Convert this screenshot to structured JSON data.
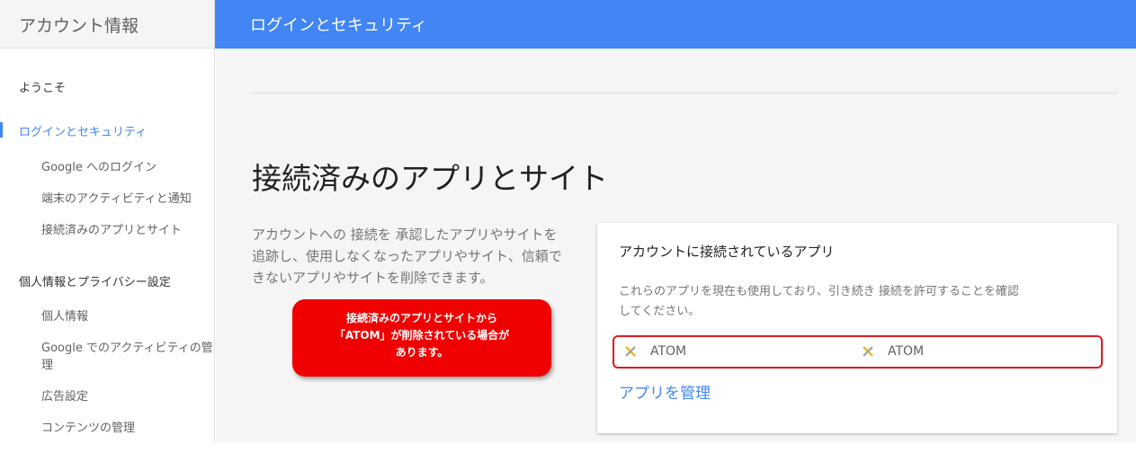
{
  "sidebar": {
    "title": "アカウント情報",
    "items": [
      {
        "label": "ようこそ"
      },
      {
        "label": "ログインとセキュリティ"
      },
      {
        "label": "Google へのログイン"
      },
      {
        "label": "端末のアクティビティと通知"
      },
      {
        "label": "接続済みのアプリとサイト"
      },
      {
        "label": "個人情報とプライバシー設定"
      },
      {
        "label": "個人情報"
      },
      {
        "label": "Google でのアクティビティの管"
      },
      {
        "label": "理"
      },
      {
        "label": "広告設定"
      },
      {
        "label": "コンテンツの管理"
      }
    ]
  },
  "header": {
    "title": "ログインとセキュリティ"
  },
  "main": {
    "section_title": "接続済みのアプリとサイト",
    "description_lines": [
      "アカウントへの 接続を 承認したアプリやサイトを",
      "追跡し、使用しなくなったアプリやサイト、信頼で",
      "きないアプリやサイトを削除できます。"
    ]
  },
  "card": {
    "title": "アカウントに接続されているアプリ",
    "description_lines": [
      "これらのアプリを現在も使用しており、引き続き 接続を許可することを確認",
      "してください。"
    ],
    "apps": [
      {
        "name": "ATOM",
        "icon": "atom-app-icon"
      },
      {
        "name": "ATOM",
        "icon": "atom-app-icon"
      }
    ],
    "manage_link": "アプリを管理"
  },
  "callout": {
    "lines": [
      "接続済みのアプリとサイトから",
      "「ATOM」が削除されている場合が",
      "あります。"
    ]
  },
  "colors": {
    "accent": "#4285f4",
    "callout": "#f00000",
    "highlight_border": "#e0191f"
  }
}
